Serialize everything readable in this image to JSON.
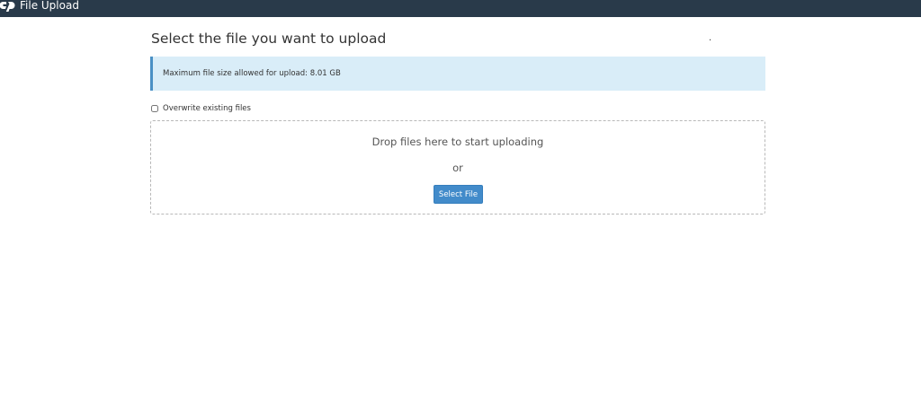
{
  "header": {
    "logo_icon": "cpanel-logo-icon",
    "title": "File Upload",
    "background_color": "#293a4a"
  },
  "main": {
    "page_title": "Select the file you want to upload",
    "stray_mark": ".",
    "info_alert": {
      "text": "Maximum file size allowed for upload: 8.01 GB",
      "background_color": "#d9edf8",
      "accent_color": "#4a90c5"
    },
    "overwrite": {
      "label": "Overwrite existing files",
      "checked": false
    },
    "dropzone": {
      "drop_text": "Drop files here to start uploading",
      "or_text": "or",
      "select_button_label": "Select File",
      "button_color": "#428bca"
    }
  }
}
